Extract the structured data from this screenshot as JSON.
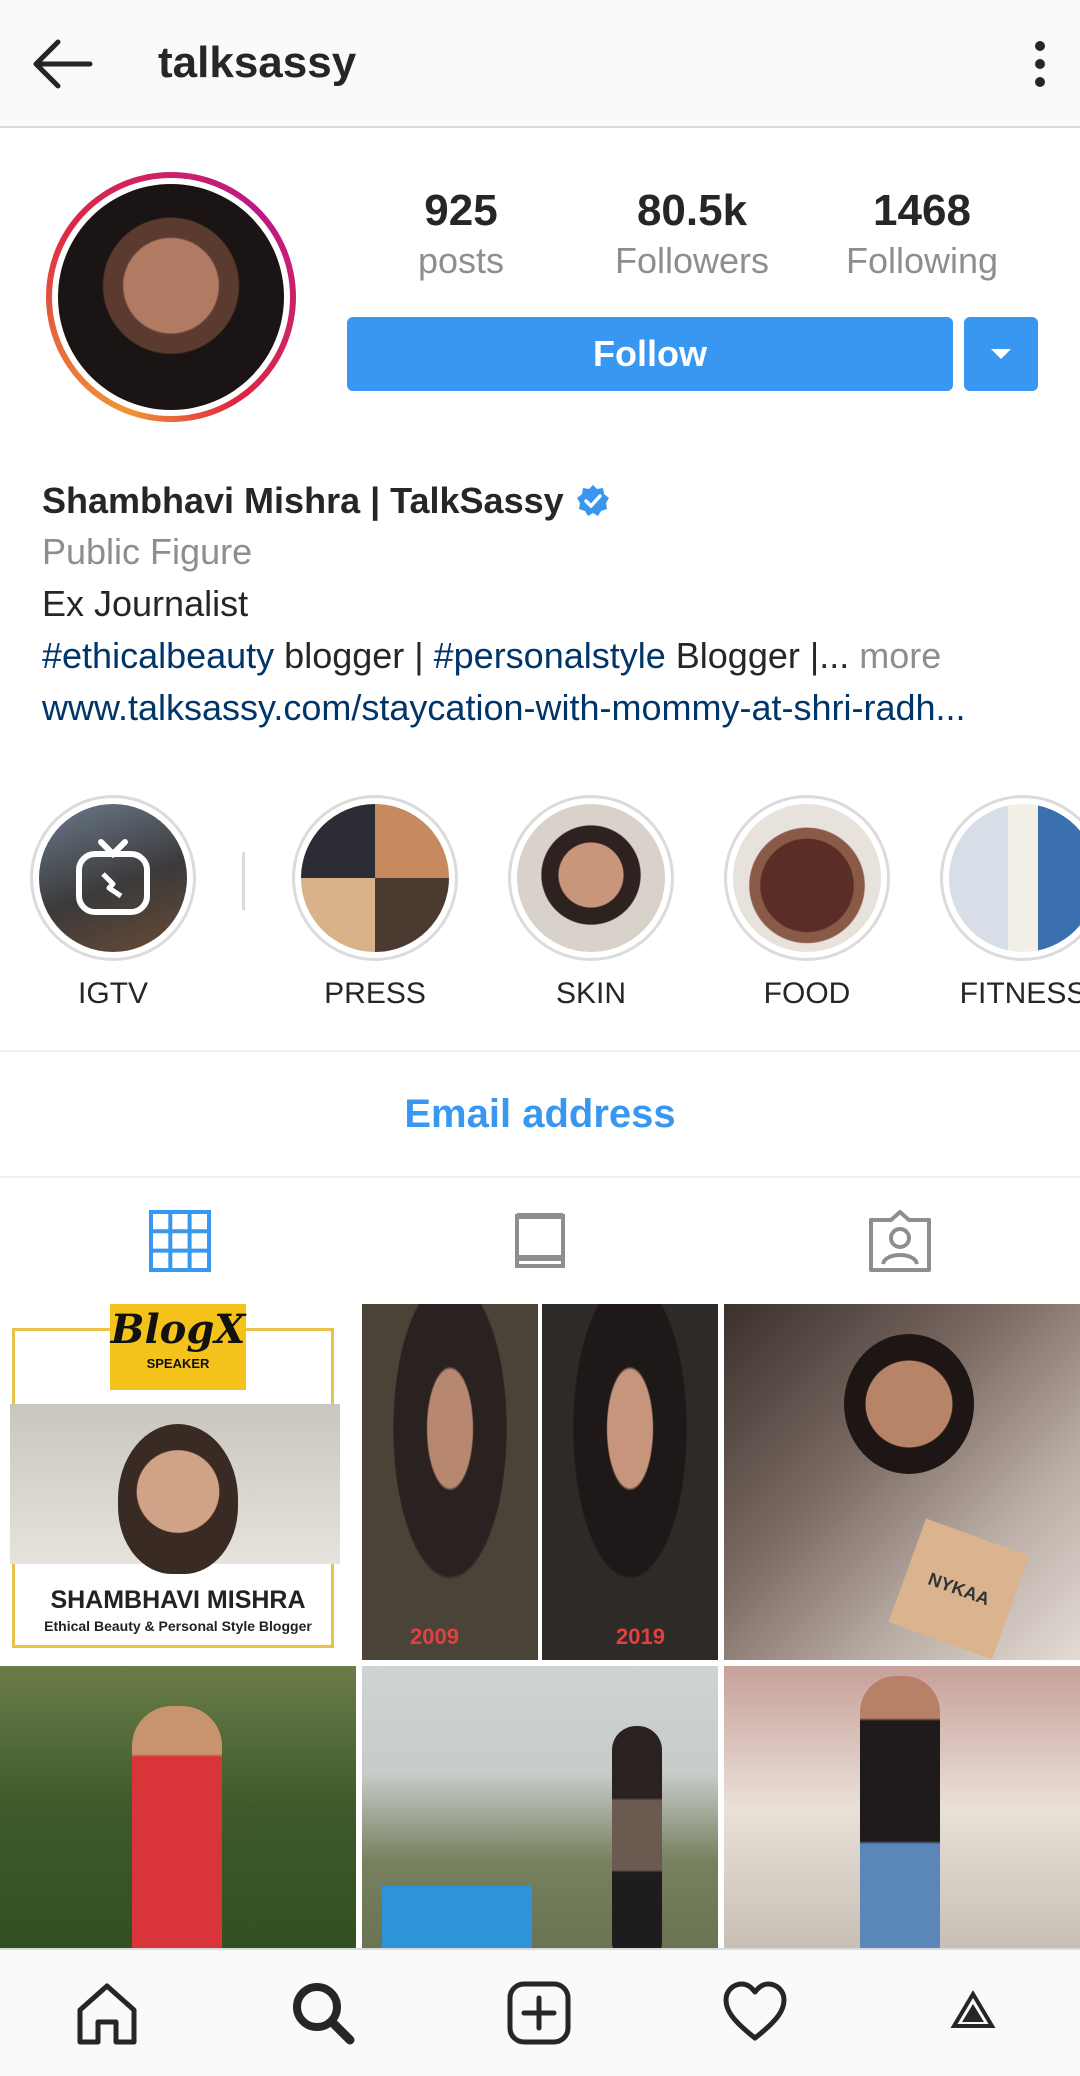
{
  "header": {
    "title": "talksassy",
    "back_icon": "arrow-left-icon",
    "more_icon": "kebab-menu-icon"
  },
  "profile": {
    "stats": [
      {
        "value": "925",
        "label": "posts"
      },
      {
        "value": "80.5k",
        "label": "Followers"
      },
      {
        "value": "1468",
        "label": "Following"
      }
    ],
    "follow_label": "Follow",
    "dropdown_icon": "caret-down-icon"
  },
  "bio": {
    "name": "Shambhavi Mishra | TalkSassy",
    "category": "Public Figure",
    "line1": "Ex Journalist",
    "hashtag1": "#ethicalbeauty",
    "text1": " blogger | ",
    "hashtag2": "#personalstyle",
    "text2": " Blogger |... ",
    "more": "more",
    "link": "www.talksassy.com/staycation-with-mommy-at-shri-radh..."
  },
  "highlights": [
    {
      "label": "IGTV"
    },
    {
      "label": "PRESS"
    },
    {
      "label": "SKIN"
    },
    {
      "label": "FOOD"
    },
    {
      "label": "FITNESS"
    }
  ],
  "contact": {
    "email_label": "Email address"
  },
  "tabs": [
    "grid-icon",
    "feed-icon",
    "tagged-icon"
  ],
  "posts": {
    "blogx_title": "BlogX",
    "blogx_sub": "SPEAKER",
    "press_name": "SHAMBHAVI MISHRA",
    "press_sub": "Ethical Beauty & Personal Style Blogger",
    "year_left": "2009",
    "year_right": "2019",
    "nykaa": "NYKAA"
  },
  "bottom_nav": [
    "home-icon",
    "search-icon",
    "add-post-icon",
    "heart-icon",
    "profile-icon"
  ],
  "colors": {
    "accent": "#3897f0",
    "link": "#003569",
    "muted": "#8e8e8e"
  }
}
